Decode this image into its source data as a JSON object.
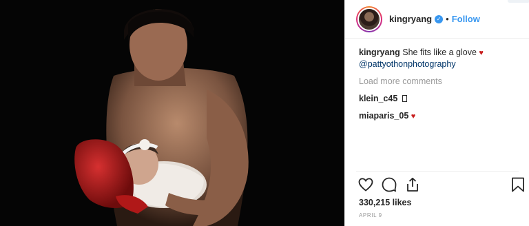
{
  "header": {
    "username": "kingryang",
    "separator": "•",
    "follow_label": "Follow",
    "icons": {
      "avatar": "profile-avatar",
      "verified": "verified-badge-icon"
    }
  },
  "caption": {
    "username": "kingryang",
    "text": "She fits like a glove",
    "emoji": "red-heart",
    "heart_glyph": "♥",
    "mention": "@pattyothonphotography"
  },
  "load_more_label": "Load more comments",
  "comments": [
    {
      "username": "klein_c45",
      "emoji": "unrendered-glyph-box"
    },
    {
      "username": "miaparis_05",
      "emoji": "red-heart",
      "heart_glyph": "♥"
    }
  ],
  "actions": {
    "icons": [
      "heart-outline-icon",
      "comment-bubble-icon",
      "share-icon",
      "bookmark-icon"
    ]
  },
  "likes_label": "330,215 likes",
  "date_label": "APRIL 9",
  "colors": {
    "link_blue": "#3897f0",
    "mention_blue": "#003569",
    "heart_red": "#c81e1e",
    "muted_gray": "#999999",
    "photo_background": "#050505"
  }
}
